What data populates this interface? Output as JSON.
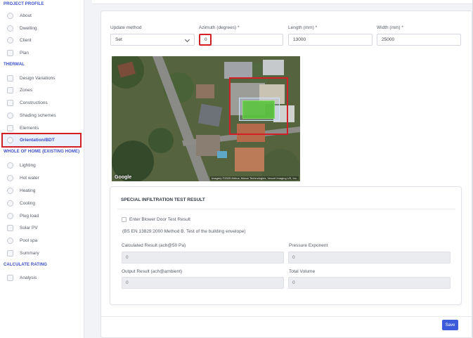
{
  "sidebar": {
    "sections": {
      "project_profile": "PROJECT PROFILE",
      "thermal": "THERMAL",
      "whole_of_home": "WHOLE OF HOME (EXISTING HOME)",
      "calculate_rating": "CALCULATE RATING"
    },
    "items": {
      "about": "About",
      "dwelling": "Dwelling",
      "client": "Client",
      "plan": "Plan",
      "design_variations": "Design Variations",
      "zones": "Zones",
      "constructions": "Constructions",
      "shading_schemes": "Shading schemes",
      "elements": "Elements",
      "orientation": "Orientation/BDT",
      "lighting": "Lighting",
      "hot_water": "Hot water",
      "heating": "Heating",
      "cooling": "Cooling",
      "plug_load": "Plug load",
      "solar_pv": "Solar PV",
      "pool_spa": "Pool spa",
      "summary": "Summary",
      "analysis": "Analysis"
    },
    "active_item": "Orientation/BDT"
  },
  "form": {
    "update_method_label": "Update method",
    "update_method_value": "Set",
    "azimuth_label": "Azimuth (degrees) *",
    "azimuth_value": "0",
    "length_label": "Length (mm) *",
    "length_value": "13000",
    "width_label": "Width (mm) *",
    "width_value": "25000"
  },
  "map": {
    "logo": "Google",
    "attribution": "Imagery ©2025 Airbus, Maxar Technologies, Vexcel Imaging US, Inc."
  },
  "infiltration": {
    "title": "SPECIAL INFILTRATION TEST RESULT",
    "checkbox_label": "Enter Blower Door Test Result",
    "checkbox_checked": false,
    "note": "(BS EN 13829:2000 Method B. Test of the building envelope)",
    "calculated_label": "Calculated Result (ach@50 Pa)",
    "calculated_value": "0",
    "pressure_label": "Pressure Exponent",
    "pressure_value": "0",
    "output_label": "Output Result (ach@ambient)",
    "output_value": "0",
    "volume_label": "Total Volume",
    "volume_value": "0"
  },
  "actions": {
    "save_label": "Save"
  },
  "colors": {
    "accent": "#3b4fc9",
    "highlight": "#d21f26",
    "save_button": "#3b5bdb"
  }
}
